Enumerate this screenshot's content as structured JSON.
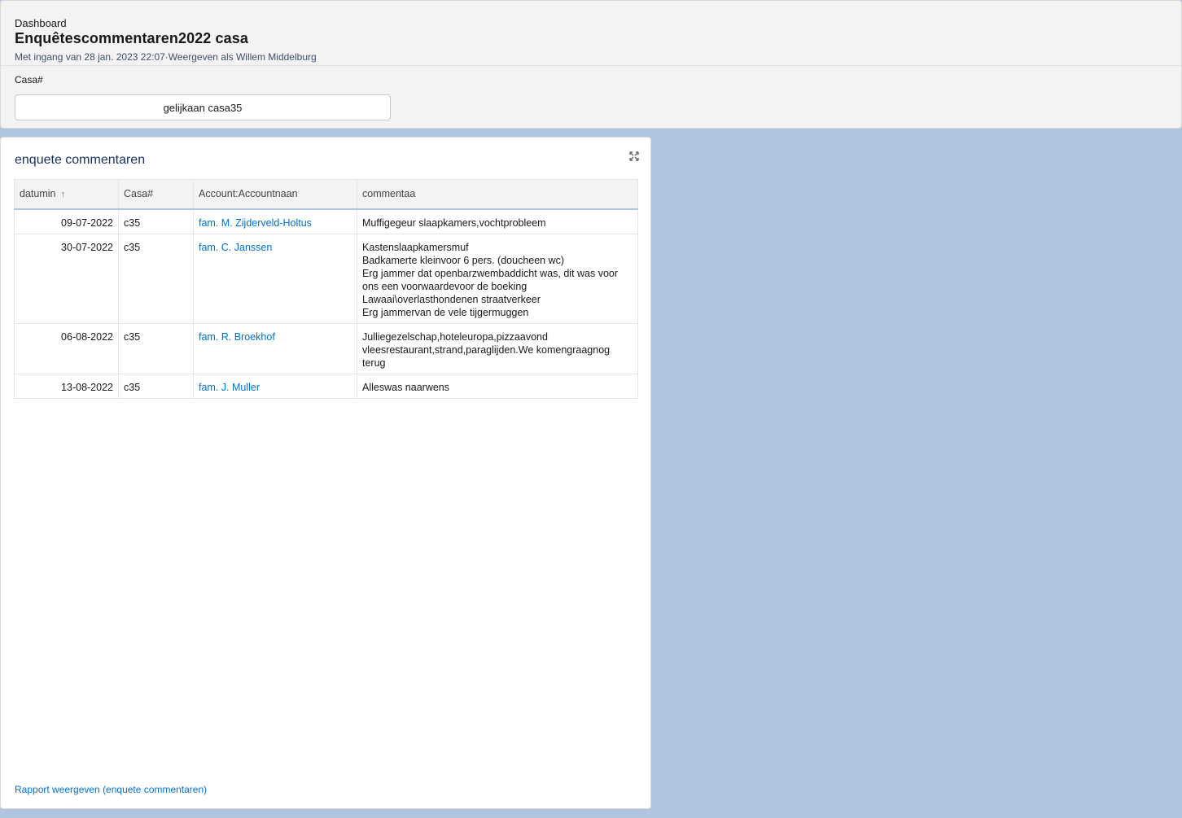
{
  "header": {
    "eyebrow": "Dashboard",
    "title": "Enquêtescommentaren2022 casa",
    "meta": "Met ingang van 28 jan. 2023 22:07·Weergeven als Willem Middelburg"
  },
  "filter": {
    "label": "Casa#",
    "value": "gelijkaan casa35"
  },
  "card": {
    "title": "enquete commentaren",
    "columns": [
      "datumin",
      "Casa#",
      "Account:Accountnaan",
      "commentaa"
    ],
    "sort_icon": "arrow-up-icon",
    "rows": [
      {
        "date": "09-07-2022",
        "casa": "c35",
        "account": "fam. M. Zijderveld-Holtus",
        "comment": "Muffigegeur slaapkamers,vochtprobleem"
      },
      {
        "date": "30-07-2022",
        "casa": "c35",
        "account": "fam. C. Janssen",
        "comment": "Kastenslaapkamersmuf\nBadkamerte kleinvoor 6 pers. (doucheen wc)\nErg jammer dat openbarzwembaddicht was, dit was voor ons een voorwaardevoor de boeking\nLawaai\\overlasthondenen straatverkeer\nErg jammervan de vele tijgermuggen"
      },
      {
        "date": "06-08-2022",
        "casa": "c35",
        "account": "fam. R. Broekhof",
        "comment": "Julliegezelschap,hoteleuropa,pizzaavond vleesrestaurant,strand,paraglijden.We komengraagnog terug"
      },
      {
        "date": "13-08-2022",
        "casa": "c35",
        "account": "fam. J. Muller",
        "comment": "Alleswas naarwens"
      }
    ],
    "report_link": "Rapport weergeven (enquete commentaren)"
  }
}
